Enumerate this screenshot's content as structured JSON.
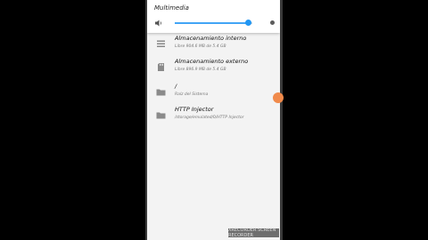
{
  "volume": {
    "title": "Multimedia",
    "level": 0.95,
    "speaker_icon": "speaker-icon"
  },
  "storage_list": [
    {
      "title": "Almacenamiento interno",
      "subtitle": "Libre 904.6 MB de 5.4 GB",
      "icon": "list-icon"
    },
    {
      "title": "Almacenamiento externo",
      "subtitle": "Libre 896.9 MB de 5.4 GB",
      "icon": "sd-card-icon"
    },
    {
      "title": "/",
      "subtitle": "Raíz del Sistema",
      "icon": "folder-icon"
    },
    {
      "title": "HTTP Injector",
      "subtitle": "/storage/emulated/0/HTTP Injector",
      "icon": "folder-icon"
    }
  ],
  "watermark": "XRECORDER SCREEN RECORDER",
  "colors": {
    "accent": "#2196f3",
    "fab": "#f08a4b",
    "background": "#f3f3f3"
  }
}
